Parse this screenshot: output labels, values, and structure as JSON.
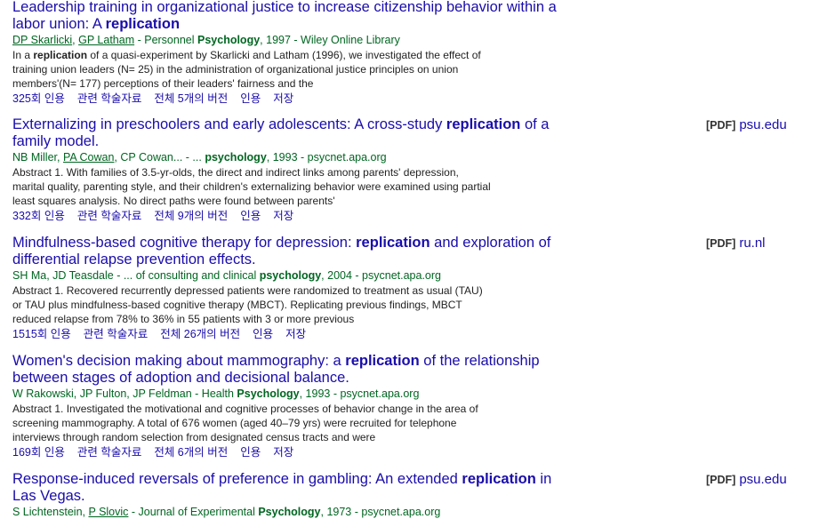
{
  "results": [
    {
      "title_pre": "Leadership training in organizational justice to increase citizenship behavior within a labor union: A ",
      "title_kw": "replication",
      "title_post": "",
      "author1": "DP Skarlicki",
      "sep1": ", ",
      "author2": "GP Latham",
      "author_rest": "",
      "source_pre": " - Personnel ",
      "source_kw": "Psychology",
      "source_post": ", 1997 - Wiley Online Library",
      "snippet_pre": "In a ",
      "snippet_kw": "replication",
      "snippet_post": " of a quasi-experiment by Skarlicki and Latham (1996), we investigated the effect of training union leaders (N= 25) in the administration of organizational justice principles on union members'(N= 177) perceptions of their leaders' fairness and the",
      "cited": "325회 인용",
      "related": "관련 학술자료",
      "versions": "전체 5개의 버전",
      "cite": "인용",
      "save": "저장",
      "side_tag": "",
      "side_domain": ""
    },
    {
      "title_pre": "Externalizing in preschoolers and early adolescents: A cross-study ",
      "title_kw": "replication",
      "title_post": " of a family model.",
      "author1": "NB Miller",
      "sep1": ", ",
      "author2": "PA Cowan",
      "author_rest": ", CP Cowan... - ... ",
      "source_pre": "",
      "source_kw": "psychology",
      "source_post": ", 1993 - psycnet.apa.org",
      "snippet_pre": "Abstract 1. With families of 3.5-yr-olds, the direct and indirect links among parents' depression, marital quality, parenting style, and their children's externalizing behavior were examined using partial least squares analysis. No direct paths were found between parents'",
      "snippet_kw": "",
      "snippet_post": "",
      "cited": "332회 인용",
      "related": "관련 학술자료",
      "versions": "전체 9개의 버전",
      "cite": "인용",
      "save": "저장",
      "side_tag": "[PDF]",
      "side_domain": "psu.edu"
    },
    {
      "title_pre": "Mindfulness-based cognitive therapy for depression: ",
      "title_kw": "replication",
      "title_post": " and exploration of differential relapse prevention effects.",
      "author1": "SH Ma, JD Teasdale",
      "sep1": "",
      "author2": "",
      "author_rest": " - ... of consulting and clinical ",
      "source_pre": "",
      "source_kw": "psychology",
      "source_post": ", 2004 - psycnet.apa.org",
      "snippet_pre": "Abstract 1. Recovered recurrently depressed patients were randomized to treatment as usual (TAU) or TAU plus mindfulness-based cognitive therapy (MBCT). Replicating previous findings, MBCT reduced relapse from 78% to 36% in 55 patients with 3 or more previous",
      "snippet_kw": "",
      "snippet_post": "",
      "cited": "1515회 인용",
      "related": "관련 학술자료",
      "versions": "전체 26개의 버전",
      "cite": "인용",
      "save": "저장",
      "side_tag": "[PDF]",
      "side_domain": "ru.nl"
    },
    {
      "title_pre": "Women's decision making about mammography: a ",
      "title_kw": "replication",
      "title_post": " of the relationship between stages of adoption and decisional balance.",
      "author1": "W Rakowski, JP Fulton, JP Feldman",
      "sep1": "",
      "author2": "",
      "author_rest": " - Health ",
      "source_pre": "",
      "source_kw": "Psychology",
      "source_post": ", 1993 - psycnet.apa.org",
      "snippet_pre": "Abstract 1. Investigated the motivational and cognitive processes of behavior change in the area of screening mammography. A total of 676 women (aged 40–79 yrs) were recruited for telephone interviews through random selection from designated census tracts and were",
      "snippet_kw": "",
      "snippet_post": "",
      "cited": "169회 인용",
      "related": "관련 학술자료",
      "versions": "전체 6개의 버전",
      "cite": "인용",
      "save": "저장",
      "side_tag": "",
      "side_domain": ""
    },
    {
      "title_pre": "Response-induced reversals of preference in gambling: An extended ",
      "title_kw": "replication",
      "title_post": " in Las Vegas.",
      "author1": "S Lichtenstein",
      "sep1": ", ",
      "author2": "P Slovic",
      "author_rest": " - Journal of Experimental ",
      "source_pre": "",
      "source_kw": "Psychology",
      "source_post": ", 1973 - psycnet.apa.org",
      "snippet_pre": "",
      "snippet_kw": "",
      "snippet_post": "",
      "cited": "",
      "related": "",
      "versions": "",
      "cite": "",
      "save": "",
      "side_tag": "[PDF]",
      "side_domain": "psu.edu"
    }
  ]
}
